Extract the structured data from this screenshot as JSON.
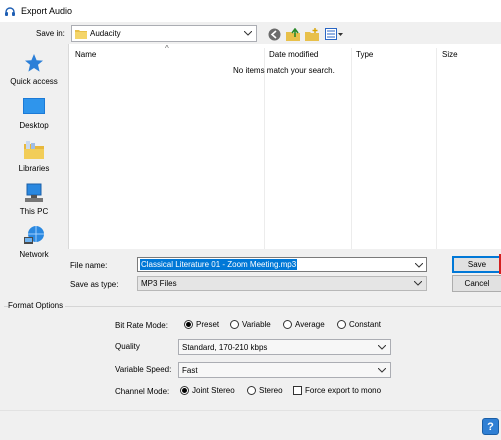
{
  "window": {
    "title": "Export Audio",
    "icon": "headphones-icon"
  },
  "save_in": {
    "label": "Save in:",
    "folder": "Audacity",
    "folder_icon": "folder-icon"
  },
  "toolbar": {
    "icons": [
      "back-icon",
      "up-folder-icon",
      "new-folder-icon",
      "view-menu-icon"
    ]
  },
  "places": [
    {
      "label": "Quick access",
      "icon": "star-icon"
    },
    {
      "label": "Desktop",
      "icon": "desktop-icon"
    },
    {
      "label": "Libraries",
      "icon": "libraries-icon"
    },
    {
      "label": "This PC",
      "icon": "computer-icon"
    },
    {
      "label": "Network",
      "icon": "network-icon"
    }
  ],
  "file_list": {
    "columns": [
      "Name",
      "Date modified",
      "Type",
      "Size"
    ],
    "empty_message": "No items match your search."
  },
  "file_name": {
    "label": "File name:",
    "value": "Classical Literature 01 - Zoom Meeting.mp3"
  },
  "save_as_type": {
    "label": "Save as type:",
    "value": "MP3 Files"
  },
  "buttons": {
    "save": "Save",
    "cancel": "Cancel"
  },
  "format_options": {
    "group_label": "Format Options",
    "bit_rate_mode": {
      "label": "Bit Rate Mode:",
      "options": [
        "Preset",
        "Variable",
        "Average",
        "Constant"
      ],
      "selected": "Preset"
    },
    "quality": {
      "label": "Quality",
      "value": "Standard, 170-210 kbps"
    },
    "variable_speed": {
      "label": "Variable Speed:",
      "value": "Fast"
    },
    "channel_mode": {
      "label": "Channel Mode:",
      "options": [
        "Joint Stereo",
        "Stereo"
      ],
      "selected": "Joint Stereo",
      "force_mono_label": "Force export to mono",
      "force_mono_checked": false
    }
  },
  "help": {
    "label": "?"
  },
  "colors": {
    "accent": "#0078d7",
    "help_blue": "#2f7fd4"
  }
}
